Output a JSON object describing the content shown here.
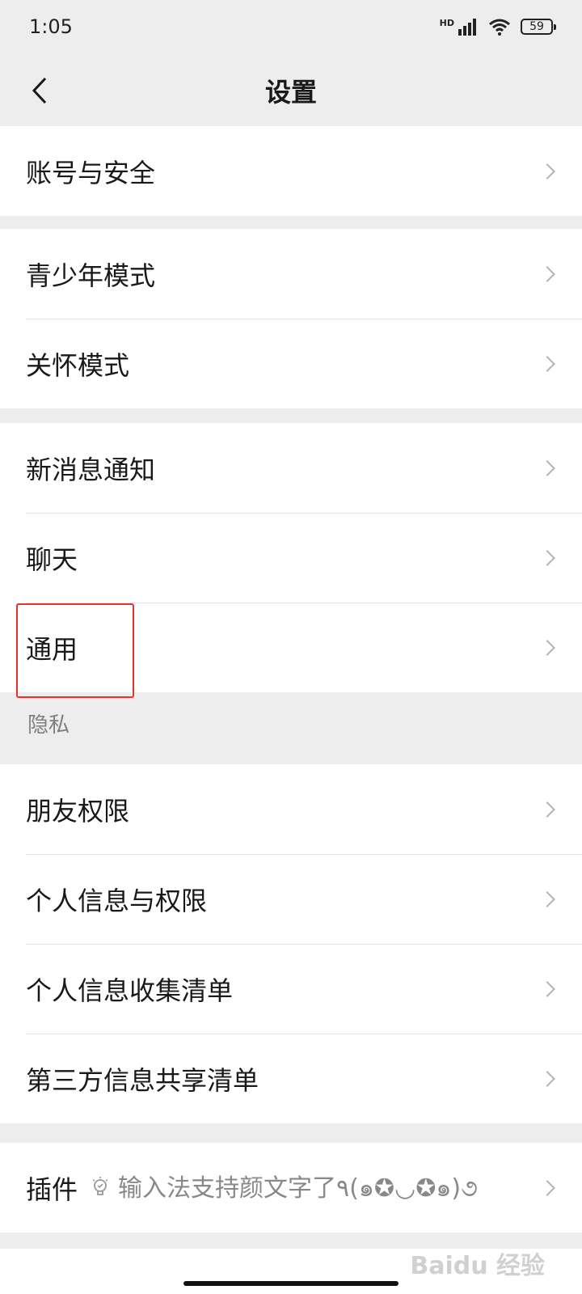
{
  "status_bar": {
    "time": "1:05",
    "network": "HD",
    "battery": "59"
  },
  "nav": {
    "title": "设置"
  },
  "groups": [
    {
      "items": [
        {
          "label": "账号与安全"
        }
      ]
    },
    {
      "items": [
        {
          "label": "青少年模式"
        },
        {
          "label": "关怀模式"
        }
      ]
    },
    {
      "items": [
        {
          "label": "新消息通知"
        },
        {
          "label": "聊天"
        },
        {
          "label": "通用"
        }
      ]
    },
    {
      "section_title": "隐私",
      "items": [
        {
          "label": "朋友权限"
        },
        {
          "label": "个人信息与权限"
        },
        {
          "label": "个人信息收集清单"
        },
        {
          "label": "第三方信息共享清单"
        }
      ]
    },
    {
      "items": [
        {
          "label": "插件",
          "tip": "输入法支持颜文字了٩(๑✪◡✪๑)૭"
        }
      ]
    }
  ],
  "watermark": "Baidu 经验",
  "colors": {
    "background": "#ededed",
    "cell": "#ffffff",
    "highlight": "#e8322b",
    "chevron": "#b2b2b2"
  }
}
